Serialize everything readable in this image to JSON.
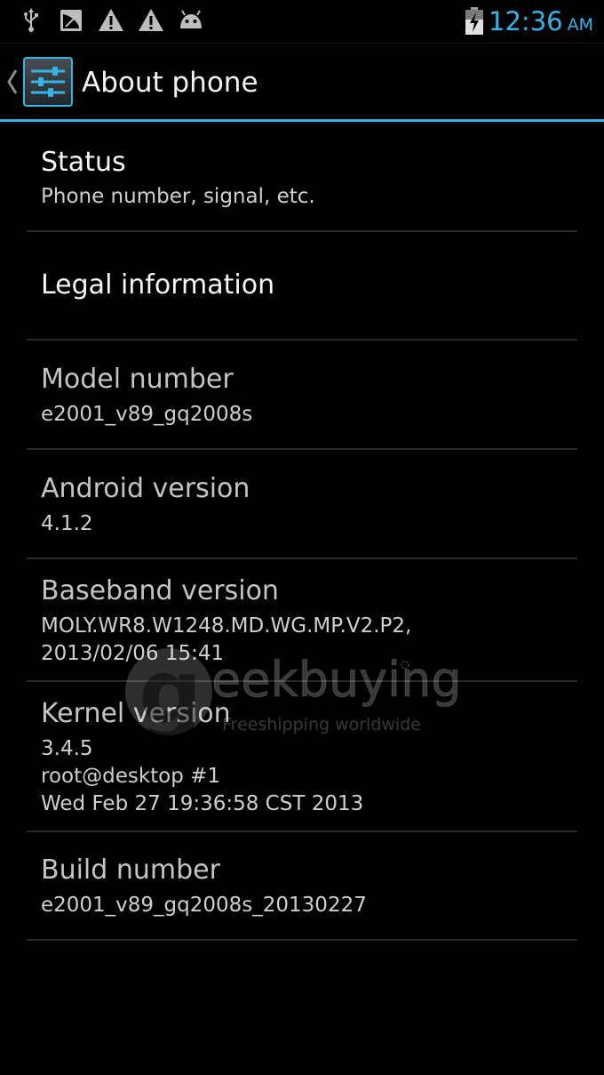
{
  "status_bar": {
    "icons": [
      "usb-icon",
      "screenshot-icon",
      "warning-icon",
      "warning-icon",
      "android-debug-icon"
    ],
    "battery": "charging-battery-icon",
    "time": "12:36",
    "ampm": "AM",
    "time_color": "#33b5e5"
  },
  "action_bar": {
    "title": "About phone",
    "icon": "settings-sliders-icon",
    "accent_color": "#33b5e5"
  },
  "items": [
    {
      "label": "Status",
      "sub": "Phone number, signal, etc."
    },
    {
      "label": "Legal information",
      "sub": ""
    },
    {
      "label": "Model number",
      "sub": "e2001_v89_gq2008s"
    },
    {
      "label": "Android version",
      "sub": "4.1.2"
    },
    {
      "label": "Baseband version",
      "sub": "MOLY.WR8.W1248.MD.WG.MP.V2.P2,\n2013/02/06 15:41"
    },
    {
      "label": "Kernel version",
      "sub": "3.4.5\nroot@desktop #1\nWed Feb 27 19:36:58 CST 2013"
    },
    {
      "label": "Build number",
      "sub": "e2001_v89_gq2008s_20130227"
    }
  ],
  "watermark": {
    "brand_letter": "g",
    "brand": "eekbuying",
    "tagline": "Freeshipping worldwide"
  }
}
